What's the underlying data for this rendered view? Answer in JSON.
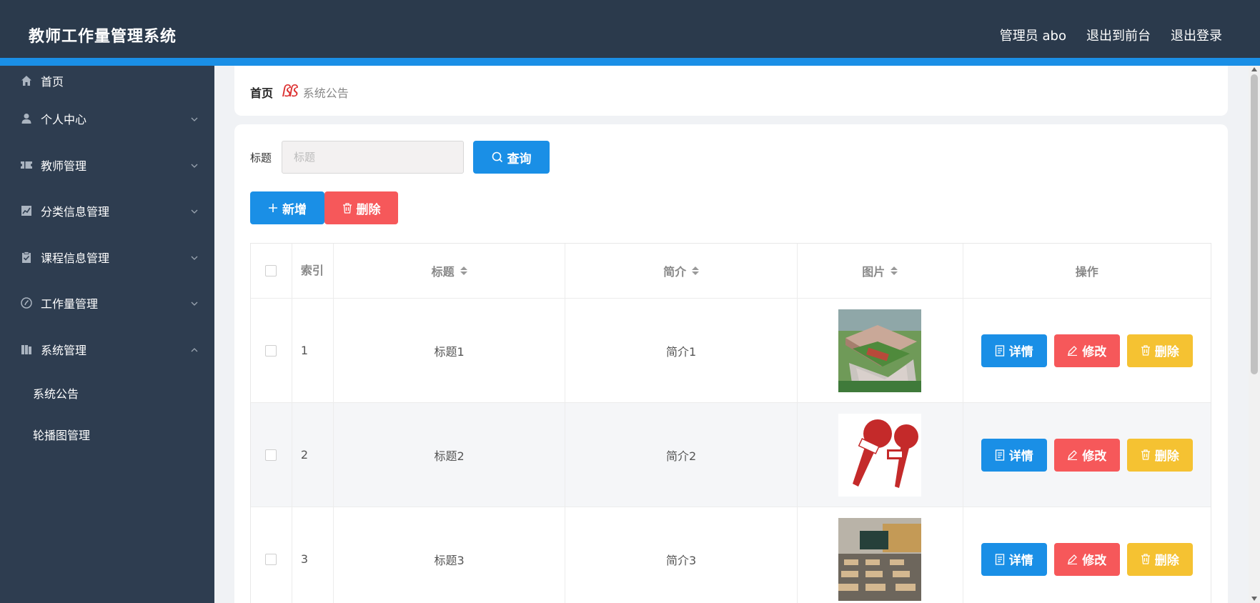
{
  "header": {
    "title": "教师工作量管理系统",
    "admin": "管理员 abo",
    "to_front": "退出到前台",
    "logout": "退出登录"
  },
  "sidebar": {
    "items": [
      {
        "label": "首页",
        "icon": "home-icon"
      },
      {
        "label": "个人中心",
        "icon": "user-icon"
      },
      {
        "label": "教师管理",
        "icon": "ticket-icon"
      },
      {
        "label": "分类信息管理",
        "icon": "chart-icon"
      },
      {
        "label": "课程信息管理",
        "icon": "clipboard-icon"
      },
      {
        "label": "工作量管理",
        "icon": "compass-icon"
      },
      {
        "label": "系统管理",
        "icon": "book-icon"
      }
    ],
    "sub_items": [
      {
        "label": "系统公告"
      },
      {
        "label": "轮播图管理"
      }
    ]
  },
  "breadcrumb": {
    "home": "首页",
    "separator": "ßß",
    "current": "系统公告"
  },
  "search": {
    "label": "标题",
    "placeholder": "标题",
    "button": "查询"
  },
  "actions": {
    "add": "新增",
    "delete": "删除"
  },
  "table": {
    "headers": {
      "index": "索引",
      "title": "标题",
      "intro": "简介",
      "image": "图片",
      "operation": "操作"
    },
    "rows": [
      {
        "index": "1",
        "title": "标题1",
        "intro": "简介1",
        "image": "campus-building-photo"
      },
      {
        "index": "2",
        "title": "标题2",
        "intro": "简介2",
        "image": "news-microphone-icon"
      },
      {
        "index": "3",
        "title": "标题3",
        "intro": "简介3",
        "image": "classroom-photo"
      }
    ],
    "op_labels": {
      "detail": "详情",
      "edit": "修改",
      "delete": "删除"
    }
  },
  "colors": {
    "header_bg": "#2b3a4c",
    "sidebar_bg": "#2e3d50",
    "accent": "#1a8fe6",
    "danger": "#f6585a",
    "warning": "#f5c232"
  }
}
